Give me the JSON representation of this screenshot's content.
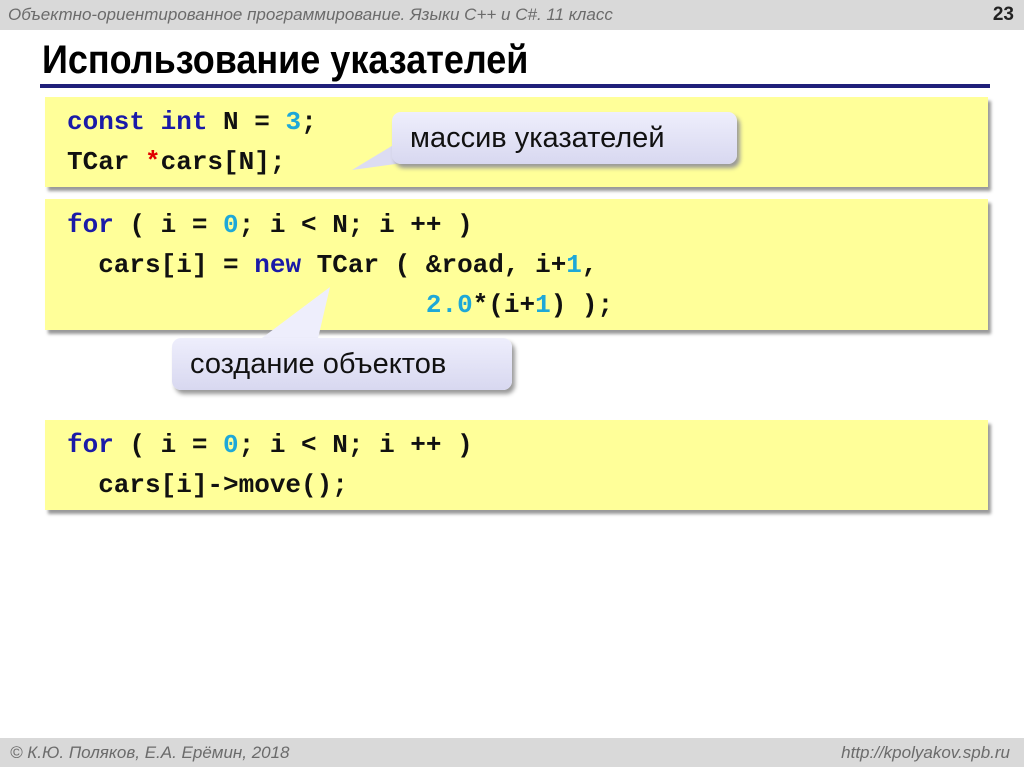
{
  "header": {
    "course": "Объектно-ориентированное программирование. Языки C++ и C#. 11 класс",
    "slide_number": "23"
  },
  "title": "Использование указателей",
  "code_blocks": [
    {
      "lines": [
        [
          [
            "const int ",
            "kw"
          ],
          [
            "N = ",
            ""
          ],
          [
            "3",
            "num"
          ],
          [
            ";",
            ""
          ]
        ],
        [
          [
            "TCar ",
            ""
          ],
          [
            "*",
            "red"
          ],
          [
            "cars[N];",
            ""
          ]
        ]
      ]
    },
    {
      "lines": [
        [
          [
            "for",
            "kw"
          ],
          [
            " ( i = ",
            ""
          ],
          [
            "0",
            "num"
          ],
          [
            "; i < N; i ++ )",
            ""
          ]
        ],
        [
          [
            "  cars[i] = ",
            ""
          ],
          [
            "new",
            "kw"
          ],
          [
            " TCar ( &road, i+",
            ""
          ],
          [
            "1",
            "num"
          ],
          [
            ",",
            ""
          ]
        ],
        [
          [
            "                       ",
            ""
          ],
          [
            "2.0",
            "num"
          ],
          [
            "*(i+",
            ""
          ],
          [
            "1",
            "num"
          ],
          [
            ") );",
            ""
          ]
        ]
      ]
    },
    {
      "lines": [
        [
          [
            "for",
            "kw"
          ],
          [
            " ( i = ",
            ""
          ],
          [
            "0",
            "num"
          ],
          [
            "; i < N; i ++ )",
            ""
          ]
        ],
        [
          [
            "  cars[i]->move();",
            ""
          ]
        ]
      ]
    }
  ],
  "callouts": {
    "pointer_array": "массив указателей",
    "object_creation": "создание объектов"
  },
  "footer": {
    "authors": "© К.Ю. Поляков, Е.А. Ерёмин, 2018",
    "url": "http://kpolyakov.spb.ru"
  }
}
